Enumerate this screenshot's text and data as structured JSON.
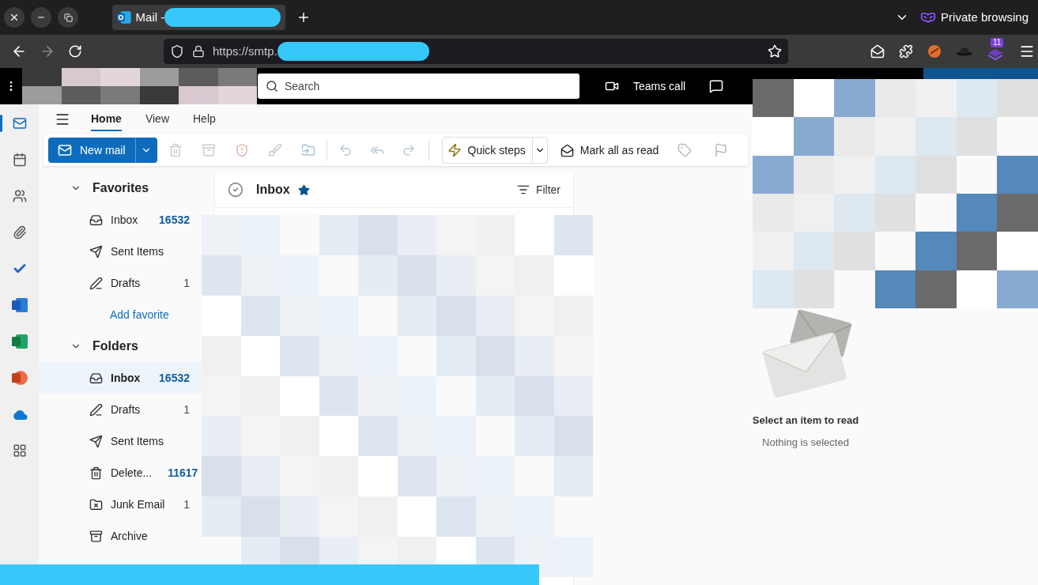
{
  "browser": {
    "tab": {
      "title": "Mail -",
      "selected": true
    },
    "private_label": "Private browsing",
    "url": "https://smtp.",
    "extension_badge": "11"
  },
  "outlook": {
    "search": {
      "placeholder": "Search"
    },
    "teams_call": "Teams call",
    "rail": [
      {
        "kind": "mail",
        "selected": true
      },
      {
        "kind": "calendar",
        "selected": false
      },
      {
        "kind": "people",
        "selected": false
      },
      {
        "kind": "files",
        "selected": false
      },
      {
        "kind": "todo",
        "selected": false
      },
      {
        "kind": "word",
        "selected": false
      },
      {
        "kind": "excel",
        "selected": false
      },
      {
        "kind": "powerpoint",
        "selected": false
      },
      {
        "kind": "onedrive",
        "selected": false
      },
      {
        "kind": "apps",
        "selected": false
      }
    ],
    "ribbon_tabs": [
      {
        "label": "Home",
        "selected": true
      },
      {
        "label": "View",
        "selected": false
      },
      {
        "label": "Help",
        "selected": false
      }
    ],
    "toolbar": {
      "new_mail": "New mail",
      "quick_steps": "Quick steps",
      "mark_all_read": "Mark all as read"
    },
    "folder_sections": [
      {
        "title": "Favorites",
        "expanded": true,
        "items": [
          {
            "kind": "inbox",
            "name": "Inbox",
            "count": "16532",
            "unread": true,
            "selected": false
          },
          {
            "kind": "sent",
            "name": "Sent Items",
            "selected": false
          },
          {
            "kind": "drafts",
            "name": "Drafts",
            "count": "1",
            "unread": false,
            "selected": false
          }
        ],
        "add_link": "Add favorite"
      },
      {
        "title": "Folders",
        "expanded": true,
        "items": [
          {
            "kind": "inbox",
            "name": "Inbox",
            "count": "16532",
            "unread": true,
            "selected": true
          },
          {
            "kind": "drafts",
            "name": "Drafts",
            "count": "1",
            "unread": false,
            "selected": false
          },
          {
            "kind": "sent",
            "name": "Sent Items",
            "selected": false
          },
          {
            "kind": "deleted",
            "name": "Delete...",
            "count": "11617",
            "unread": true,
            "selected": false
          },
          {
            "kind": "junk",
            "name": "Junk Email",
            "count": "1",
            "unread": false,
            "selected": false
          },
          {
            "kind": "archive",
            "name": "Archive",
            "selected": false
          }
        ]
      }
    ],
    "message_list": {
      "title": "Inbox",
      "favorite": true,
      "filter": "Filter"
    },
    "reading_pane": {
      "title": "Select an item to read",
      "subtitle": "Nothing is selected"
    }
  }
}
